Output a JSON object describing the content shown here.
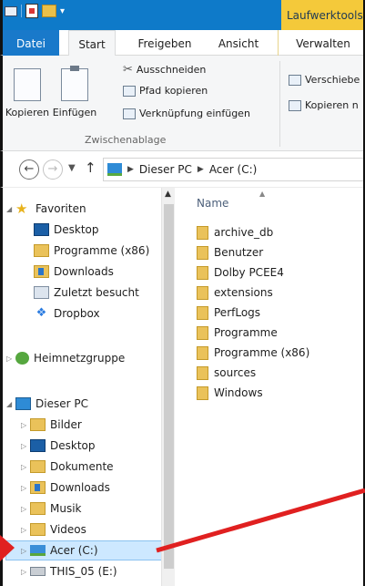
{
  "titlebar": {
    "context_tab": "Laufwerktools"
  },
  "ribbon_tabs": {
    "file": "Datei",
    "start": "Start",
    "share": "Freigeben",
    "view": "Ansicht",
    "manage": "Verwalten"
  },
  "clipboard": {
    "copy": "Kopieren",
    "paste": "Einfügen",
    "cut": "Ausschneiden",
    "copy_path": "Pfad kopieren",
    "paste_shortcut": "Verknüpfung einfügen",
    "group_label": "Zwischenablage"
  },
  "organize": {
    "move_to": "Verschiebe",
    "copy_to": "Kopieren n"
  },
  "address": {
    "crumb1": "Dieser PC",
    "crumb2": "Acer (C:)"
  },
  "nav": {
    "favorites": "Favoriten",
    "fav_items": [
      "Desktop",
      "Programme (x86)",
      "Downloads",
      "Zuletzt besucht",
      "Dropbox"
    ],
    "homegroup": "Heimnetzgruppe",
    "this_pc": "Dieser PC",
    "pc_items": [
      "Bilder",
      "Desktop",
      "Dokumente",
      "Downloads",
      "Musik",
      "Videos",
      "Acer (C:)",
      "THIS_05 (E:)"
    ]
  },
  "content": {
    "column_name": "Name",
    "files": [
      "archive_db",
      "Benutzer",
      "Dolby PCEE4",
      "extensions",
      "PerfLogs",
      "Programme",
      "Programme (x86)",
      "sources",
      "Windows"
    ]
  },
  "colors": {
    "titlebar": "#0e7ac9",
    "file_tab": "#1979ca",
    "context_tab": "#f4c93a",
    "selection": "#cde8ff",
    "annotation_arrow": "#e02020"
  }
}
